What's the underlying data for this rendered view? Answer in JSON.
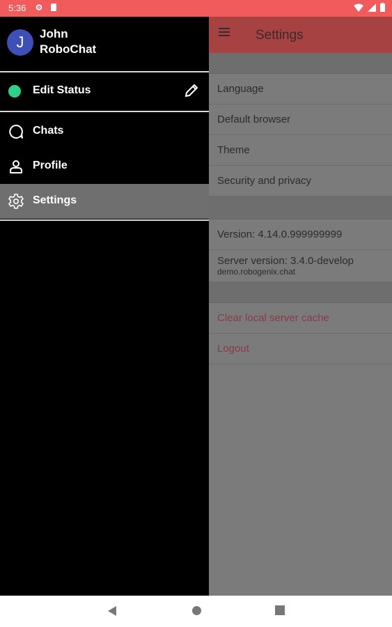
{
  "status_bar": {
    "time": "5:36"
  },
  "drawer": {
    "user": {
      "avatar_letter": "J",
      "name": "John RoboChat"
    },
    "status_label": "Edit Status",
    "items": [
      {
        "label": "Chats",
        "icon": "chat-bubble-icon"
      },
      {
        "label": "Profile",
        "icon": "person-icon"
      },
      {
        "label": "Settings",
        "icon": "gear-icon",
        "active": true
      }
    ]
  },
  "settings": {
    "title": "Settings",
    "rows": [
      {
        "label": "Language"
      },
      {
        "label": "Default browser"
      },
      {
        "label": "Theme"
      },
      {
        "label": "Security and privacy"
      }
    ],
    "version": "Version: 4.14.0.999999999",
    "server_version": "Server version: 3.4.0-develop",
    "server_host": "demo.robogenix.chat",
    "clear_cache": "Clear local server cache",
    "logout": "Logout"
  },
  "colors": {
    "status_bar": "#f25b5b",
    "app_bar": "#a64242",
    "status_dot": "#2fd18a",
    "avatar": "#3f4fb8",
    "danger_text": "#8a3a4a"
  }
}
